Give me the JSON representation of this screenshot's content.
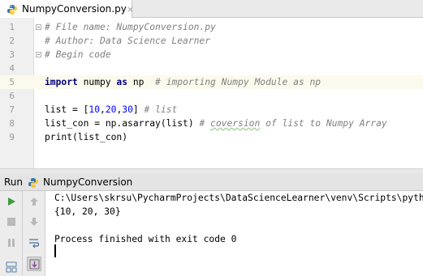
{
  "editor_tab": {
    "filename": "NumpyConversion.py",
    "close": "×"
  },
  "editor": {
    "lines": [
      {
        "num": "1",
        "tokens": [
          {
            "t": "# File name: NumpyConversion.py",
            "c": "cmt"
          }
        ]
      },
      {
        "num": "2",
        "tokens": [
          {
            "t": "# Author: Data Science Learner",
            "c": "cmt"
          }
        ]
      },
      {
        "num": "3",
        "tokens": [
          {
            "t": "# Begin code",
            "c": "cmt"
          }
        ]
      },
      {
        "num": "4",
        "tokens": []
      },
      {
        "num": "5",
        "tokens": [
          {
            "t": "import",
            "c": "kw"
          },
          {
            "t": " numpy ",
            "c": ""
          },
          {
            "t": "as",
            "c": "kw"
          },
          {
            "t": " np  ",
            "c": ""
          },
          {
            "t": "# importing Numpy Module as np",
            "c": "cmt"
          }
        ]
      },
      {
        "num": "6",
        "tokens": []
      },
      {
        "num": "7",
        "tokens": [
          {
            "t": "list = [",
            "c": ""
          },
          {
            "t": "10",
            "c": "num"
          },
          {
            "t": ",",
            "c": ""
          },
          {
            "t": "20",
            "c": "num"
          },
          {
            "t": ",",
            "c": ""
          },
          {
            "t": "30",
            "c": "num"
          },
          {
            "t": "] ",
            "c": ""
          },
          {
            "t": "# list",
            "c": "cmt"
          }
        ]
      },
      {
        "num": "8",
        "tokens": [
          {
            "t": "list_con = np.asarray(list) ",
            "c": ""
          },
          {
            "t": "# ",
            "c": "cmt"
          },
          {
            "t": "coversion",
            "c": "cmt squig"
          },
          {
            "t": " of list to Numpy Array",
            "c": "cmt"
          }
        ]
      },
      {
        "num": "9",
        "tokens": [
          {
            "t": "print(list_con)",
            "c": ""
          }
        ]
      }
    ]
  },
  "run_panel": {
    "title": "Run",
    "config_name": "NumpyConversion",
    "console_lines": [
      "C:\\Users\\skrsu\\PycharmProjects\\DataScienceLearner\\venv\\Scripts\\python.exe",
      "{10, 20, 30}",
      "",
      "Process finished with exit code 0"
    ]
  },
  "colors": {
    "comment": "#808080",
    "keyword": "#000080",
    "number": "#0000ff",
    "run_green": "#3d9b3d",
    "python_blue": "#3c78aa",
    "python_yellow": "#f5c93a"
  }
}
